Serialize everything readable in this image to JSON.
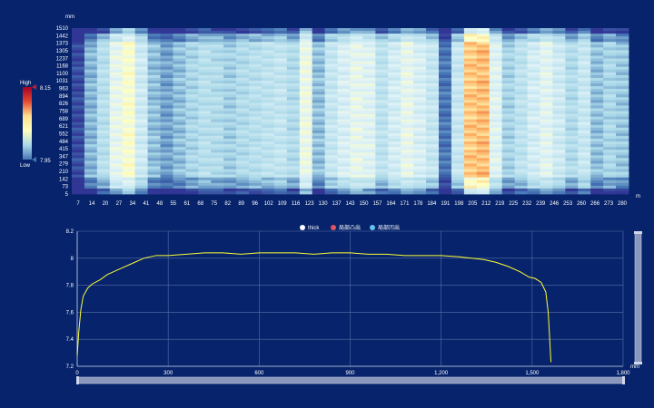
{
  "colors": {
    "background": "#06236b",
    "line": "#ffff33",
    "grid": "#5a6fa8",
    "scroll": "#8a97bd"
  },
  "heatmap": {
    "type": "heatmap",
    "y_unit": "mm",
    "x_unit": "m",
    "y_ticks": [
      "5",
      "73",
      "142",
      "210",
      "279",
      "347",
      "415",
      "484",
      "552",
      "621",
      "689",
      "758",
      "826",
      "894",
      "963",
      "1031",
      "1100",
      "1168",
      "1237",
      "1305",
      "1373",
      "1442",
      "1510"
    ],
    "x_ticks": [
      "7",
      "14",
      "20",
      "27",
      "34",
      "41",
      "48",
      "55",
      "61",
      "68",
      "75",
      "82",
      "89",
      "96",
      "102",
      "109",
      "116",
      "123",
      "130",
      "137",
      "143",
      "150",
      "157",
      "164",
      "171",
      "178",
      "184",
      "191",
      "198",
      "205",
      "212",
      "219",
      "225",
      "232",
      "239",
      "246",
      "253",
      "260",
      "266",
      "273",
      "280"
    ],
    "visual_map": {
      "high_label": "High",
      "low_label": "Low",
      "max": "8.15",
      "min": "7.95",
      "max_value": 8.15,
      "min_value": 7.95
    },
    "column_levels": [
      0.05,
      0.28,
      0.4,
      0.58,
      0.66,
      0.48,
      0.3,
      0.24,
      0.3,
      0.36,
      0.4,
      0.38,
      0.34,
      0.38,
      0.4,
      0.42,
      0.44,
      0.38,
      0.6,
      0.3,
      0.45,
      0.52,
      0.58,
      0.55,
      0.42,
      0.5,
      0.58,
      0.52,
      0.45,
      0.15,
      0.45,
      0.8,
      0.82,
      0.55,
      0.35,
      0.42,
      0.5,
      0.56,
      0.48,
      0.38,
      0.46,
      0.3,
      0.36,
      0.32
    ]
  },
  "line_chart": {
    "type": "line",
    "legend": [
      {
        "name": "thick",
        "color": "#ffffff"
      },
      {
        "name": "局部凸出",
        "color": "#e0545f"
      },
      {
        "name": "局部凹出",
        "color": "#62c6ef"
      }
    ],
    "x_unit": "mm",
    "xlim": [
      0,
      1800
    ],
    "ylim": [
      7.2,
      8.2
    ],
    "x_ticks": [
      "0",
      "300",
      "600",
      "900",
      "1,200",
      "1,500",
      "1,800"
    ],
    "y_ticks": [
      "7.2",
      "7.4",
      "7.6",
      "7.8",
      "8",
      "8.2"
    ],
    "series": [
      {
        "name": "thick",
        "x": [
          0,
          5,
          12,
          20,
          35,
          50,
          75,
          100,
          140,
          180,
          220,
          260,
          300,
          360,
          420,
          480,
          540,
          600,
          660,
          720,
          780,
          840,
          900,
          960,
          1020,
          1080,
          1140,
          1200,
          1260,
          1300,
          1340,
          1380,
          1420,
          1460,
          1490,
          1510,
          1530,
          1545,
          1553,
          1558,
          1562
        ],
        "y": [
          7.28,
          7.45,
          7.62,
          7.72,
          7.78,
          7.81,
          7.84,
          7.88,
          7.92,
          7.96,
          8.0,
          8.02,
          8.02,
          8.03,
          8.04,
          8.04,
          8.03,
          8.04,
          8.04,
          8.04,
          8.03,
          8.04,
          8.04,
          8.03,
          8.03,
          8.02,
          8.02,
          8.02,
          8.01,
          8.0,
          7.99,
          7.97,
          7.94,
          7.9,
          7.86,
          7.85,
          7.82,
          7.75,
          7.6,
          7.4,
          7.23
        ]
      }
    ]
  }
}
